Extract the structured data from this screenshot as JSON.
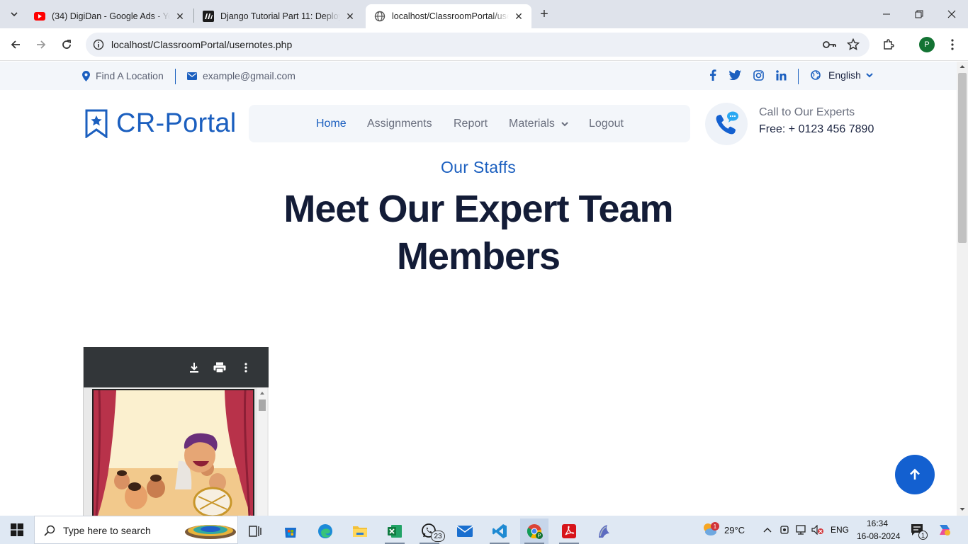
{
  "browser": {
    "tabs": [
      {
        "title": "(34) DigiDan - Google Ads - YouTube",
        "icon": "youtube-icon"
      },
      {
        "title": "Django Tutorial Part 11: Deploying Django to production",
        "icon": "mdn-icon"
      },
      {
        "title": "localhost/ClassroomPortal/usernotes.php",
        "icon": "globe-icon"
      }
    ],
    "url": "localhost/ClassroomPortal/usernotes.php",
    "profile_initial": "P"
  },
  "topbar": {
    "location": "Find A Location",
    "email": "example@gmail.com",
    "language": "English"
  },
  "site": {
    "logo_text": "CR-Portal",
    "nav": [
      "Home",
      "Assignments",
      "Report",
      "Materials",
      "Logout"
    ],
    "call_title": "Call to Our Experts",
    "call_number": "Free: + 0123 456 7890"
  },
  "section": {
    "subtitle": "Our Staffs",
    "heading": "Meet Our Expert Team Members"
  },
  "taskbar": {
    "search_placeholder": "Type here to search",
    "whatsapp_badge": "23",
    "weather": "29°C",
    "weather_badge": "1",
    "language": "ENG",
    "time": "16:34",
    "date": "16-08-2024",
    "notification_count": "1"
  },
  "colors": {
    "brand": "#1b5fbf",
    "heading": "#131c37",
    "back_to_top": "#1360d0"
  }
}
